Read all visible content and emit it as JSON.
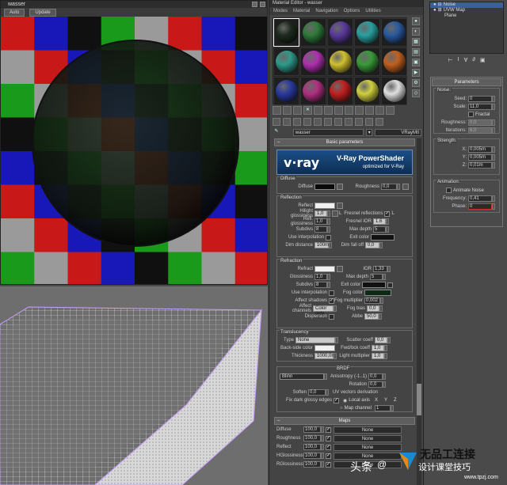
{
  "render_window": {
    "title": "wasser",
    "toolbar": [
      "Auto",
      "Update"
    ]
  },
  "material_editor": {
    "title": "Material Editor - wasser",
    "menu": [
      "Modes",
      "Material",
      "Navigation",
      "Options",
      "Utilities"
    ],
    "material_name": "wasser",
    "material_type": "VRayMtl",
    "slot_colors": [
      "#1f2b1f",
      "#2f7a3a",
      "#5a3a9a",
      "#2aa0a0",
      "#2a5aa0",
      "#2f9a8a",
      "#b030b0",
      "#d0c030",
      "#3a9a3a",
      "#c06020",
      "#2a3aa0",
      "#b03080",
      "#c02020",
      "#d0d040",
      "#e0e0e0"
    ],
    "rollout_basic": "Basic parameters",
    "vray_title": "V-Ray PowerShader",
    "vray_subtitle": "optimized for V-Ray",
    "vray_logo": "v·ray",
    "diffuse": {
      "group": "Diffuse",
      "diffuse_label": "Diffuse",
      "roughness_label": "Roughness",
      "roughness_value": "0,0"
    },
    "reflection": {
      "group": "Reflection",
      "reflect": "Reflect",
      "hilight_gloss": "Hilight glossiness",
      "hilight_gloss_value": "1,0",
      "lock": "L",
      "fresnel": "Fresnel reflections",
      "refl_gloss": "Refl. glossiness",
      "refl_gloss_value": "1,0",
      "fresnel_ior": "Fresnel IOR",
      "fresnel_ior_value": "1,6",
      "subdivs": "Subdivs",
      "subdivs_value": "8",
      "max_depth": "Max depth",
      "max_depth_value": "5",
      "use_interp": "Use interpolation",
      "exit_color": "Exit color",
      "dim_distance": "Dim distance",
      "dim_distance_value": "100m",
      "dim_falloff": "Dim fall off",
      "dim_falloff_value": "0,0"
    },
    "refraction": {
      "group": "Refraction",
      "refract": "Refract",
      "ior": "IOR",
      "ior_value": "1,33",
      "glossiness": "Glossiness",
      "glossiness_value": "1,0",
      "max_depth": "Max depth",
      "max_depth_value": "5",
      "subdivs": "Subdivs",
      "subdivs_value": "8",
      "exit_color": "Exit color",
      "use_interp": "Use interpolation",
      "fog_color": "Fog color",
      "affect_shadows": "Affect shadows",
      "fog_multiplier": "Fog multiplier",
      "fog_multiplier_value": "0,002",
      "affect_channels": "Affect channels",
      "affect_channels_value": "Color only",
      "fog_bias": "Fog bias",
      "fog_bias_value": "0,0",
      "dispersion": "Dispersion",
      "abbe": "Abbe",
      "abbe_value": "50,0"
    },
    "translucency": {
      "group": "Translucency",
      "type": "Type",
      "type_value": "None",
      "scatter_coeff": "Scatter coeff",
      "scatter_coeff_value": "0,0",
      "back_side_color": "Back-side color",
      "fwd_bck_coeff": "Fwd/bck coeff",
      "fwd_bck_coeff_value": "1,0",
      "thickness": "Thickness",
      "thickness_value": "1000,0m",
      "light_multiplier": "Light multiplier",
      "light_multiplier_value": "1,0"
    },
    "brdf": {
      "group": "BRDF",
      "type_value": "Blinn",
      "anisotropy": "Anisotropy (-1..1)",
      "anisotropy_value": "0,0",
      "rotation": "Rotation",
      "rotation_value": "0,0",
      "soften": "Soften",
      "soften_value": "0,0",
      "uv_derivation": "UV vectors derivation",
      "local_axis": "Local axis",
      "axes": [
        "X",
        "Y",
        "Z"
      ],
      "fix_dark": "Fix dark glossy edges",
      "map_channel": "Map channel",
      "map_channel_value": "1"
    },
    "maps": {
      "rollout": "Maps",
      "rows": [
        {
          "name": "Diffuse",
          "value": "100,0",
          "map": "None"
        },
        {
          "name": "Roughness",
          "value": "100,0",
          "map": "None"
        },
        {
          "name": "Reflect",
          "value": "100,0",
          "map": "None"
        },
        {
          "name": "HGlossiness",
          "value": "100,0",
          "map": "None"
        },
        {
          "name": "RGlossiness",
          "value": "100,0",
          "map": "None"
        }
      ]
    }
  },
  "command_panel": {
    "stack": [
      "Noise",
      "UVW Map",
      "Plane"
    ],
    "params_rollout": "Parameters",
    "noise": {
      "group": "Noise:",
      "seed_label": "Seed:",
      "seed": "0",
      "scale_label": "Scale:",
      "scale": "11,0",
      "fractal": "Fractal",
      "roughness_label": "Roughness:",
      "roughness": "0,0",
      "iterations_label": "Iterations:",
      "iterations": "6,0"
    },
    "strength": {
      "group": "Strength:",
      "x_label": "X:",
      "x": "0,005m",
      "y_label": "Y:",
      "y": "0,005m",
      "z_label": "Z:",
      "z": "0,01m"
    },
    "animation": {
      "group": "Animation:",
      "animate_noise": "Animate Noise",
      "frequency_label": "Frequency:",
      "frequency": "0,41",
      "phase_label": "Phase:",
      "phase": "0"
    }
  },
  "watermark": {
    "prefix": "头条",
    "handle": "@",
    "name": "设计课堂技巧",
    "logo_text": "无品工连接",
    "url": "www.tpzj.com"
  }
}
